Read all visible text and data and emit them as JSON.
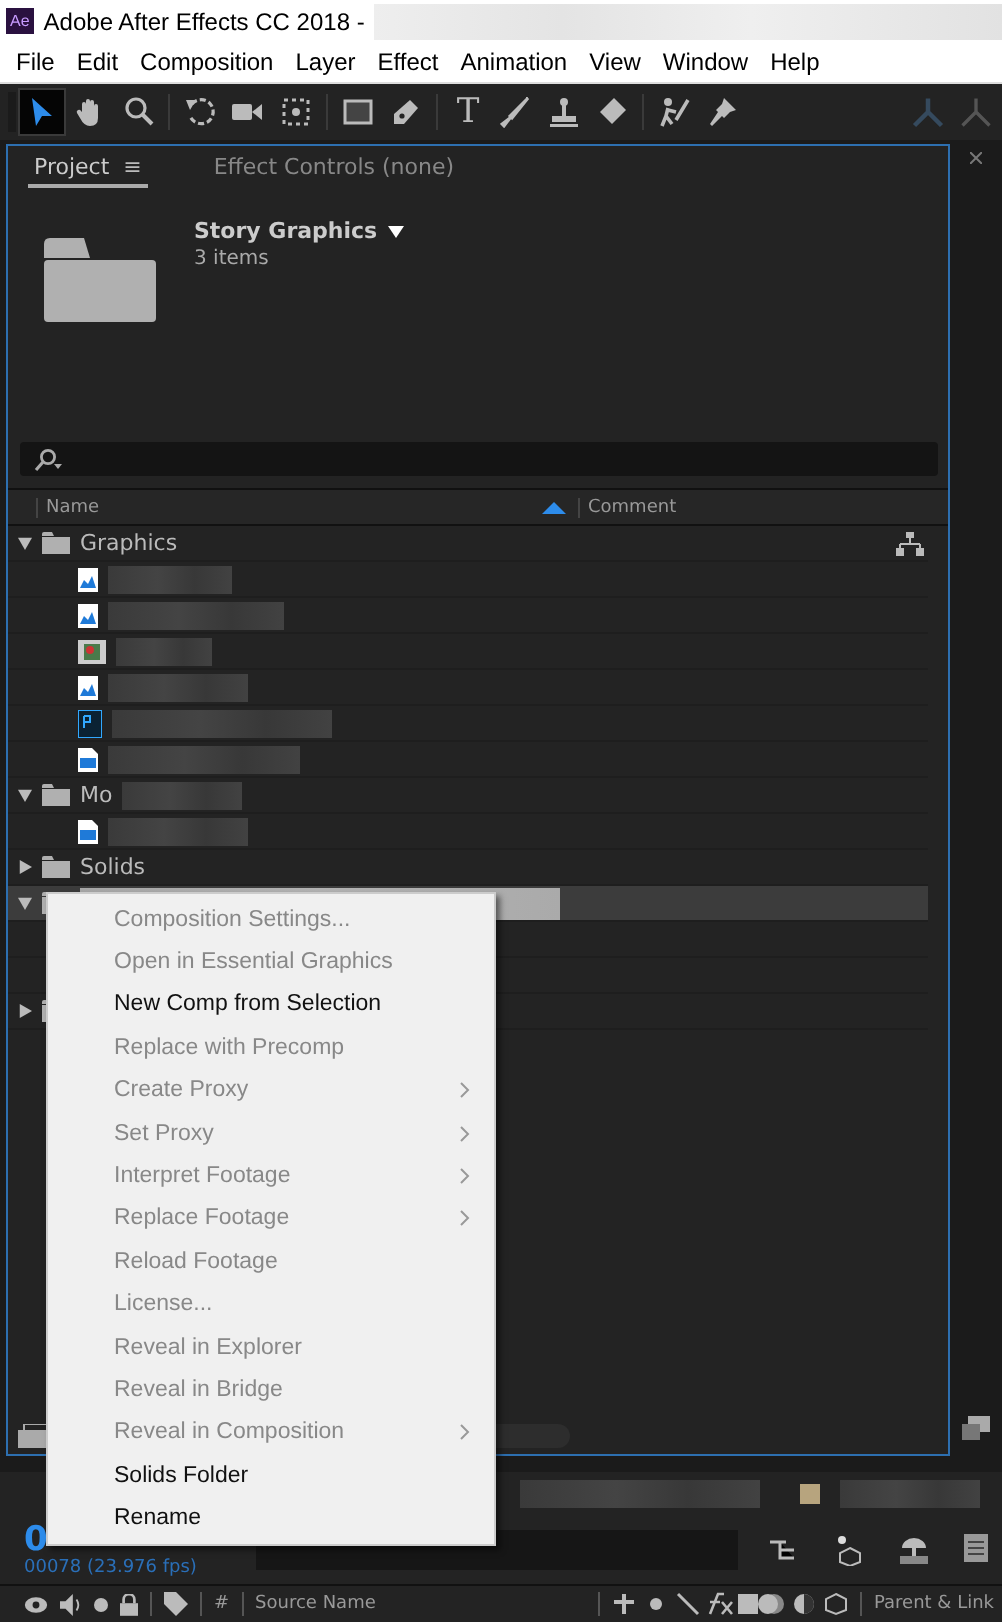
{
  "window": {
    "title": "Adobe After Effects CC 2018 -",
    "app_badge": "Ae"
  },
  "menu_bar": [
    "File",
    "Edit",
    "Composition",
    "Layer",
    "Effect",
    "Animation",
    "View",
    "Window",
    "Help"
  ],
  "toolbar": [
    {
      "kind": "arrow",
      "selected": true
    },
    {
      "kind": "hand",
      "selected": false
    },
    {
      "kind": "zoom",
      "selected": false
    },
    {
      "kind": "rotate",
      "selected": false
    },
    {
      "kind": "camera",
      "selected": false
    },
    {
      "kind": "pan",
      "selected": false
    },
    {
      "kind": "rect",
      "selected": false
    },
    {
      "kind": "pen",
      "selected": false
    },
    {
      "kind": "text",
      "glyph": "T",
      "selected": false
    },
    {
      "kind": "brush",
      "selected": false
    },
    {
      "kind": "stamp",
      "selected": false
    },
    {
      "kind": "eraser",
      "selected": false
    },
    {
      "kind": "roto",
      "selected": false
    },
    {
      "kind": "pin",
      "selected": false
    }
  ],
  "tabs": [
    {
      "label": "Project",
      "menu_glyph": "≡",
      "selected": true
    },
    {
      "label": "Effect Controls (none)",
      "selected": false
    }
  ],
  "preview": {
    "name": "Story Graphics",
    "count": "3 items"
  },
  "columns": [
    "Name",
    "Comment"
  ],
  "tree": [
    {
      "kind": "folder",
      "name": "Graphics",
      "expanded": true,
      "selected": false,
      "children": [
        {
          "kind": "image"
        },
        {
          "kind": "image"
        },
        {
          "kind": "sequence"
        },
        {
          "kind": "image"
        },
        {
          "kind": "psd"
        },
        {
          "kind": "file"
        }
      ]
    },
    {
      "kind": "folder",
      "name": "Mo",
      "redacted": true,
      "expanded": true,
      "selected": false,
      "children": [
        {
          "kind": "file"
        }
      ]
    },
    {
      "kind": "folder",
      "name": "Solids",
      "expanded": false,
      "selected": false
    },
    {
      "kind": "folder",
      "expanded": true,
      "selected": true,
      "children": [
        {
          "kind": "blank"
        },
        {
          "kind": "blank"
        }
      ]
    },
    {
      "kind": "folder",
      "expanded": false,
      "selected": false
    }
  ],
  "context_menu": [
    {
      "label": "Composition Settings...",
      "disabled": true
    },
    {
      "label": "Open in Essential Graphics",
      "disabled": true
    },
    {
      "label": "New Comp from Selection",
      "disabled": false
    },
    {
      "label": "Replace with Precomp",
      "disabled": true
    },
    {
      "label": "Create Proxy",
      "disabled": true,
      "submenu": true
    },
    {
      "label": "Set Proxy",
      "disabled": true,
      "submenu": true
    },
    {
      "label": "Interpret Footage",
      "disabled": true,
      "submenu": true
    },
    {
      "label": "Replace Footage",
      "disabled": true,
      "submenu": true
    },
    {
      "label": "Reload Footage",
      "disabled": true
    },
    {
      "label": "License...",
      "disabled": true
    },
    {
      "label": "Reveal in Explorer",
      "disabled": true
    },
    {
      "label": "Reveal in Bridge",
      "disabled": true
    },
    {
      "label": "Reveal in Composition",
      "disabled": true,
      "submenu": true
    },
    {
      "label": "Solids Folder",
      "disabled": false
    },
    {
      "label": "Rename",
      "disabled": false
    }
  ],
  "timeline": {
    "timecode": "0",
    "frames": "00078 (23.976 fps)",
    "columns": [
      "#",
      "Source Name",
      "Parent & Link"
    ]
  }
}
